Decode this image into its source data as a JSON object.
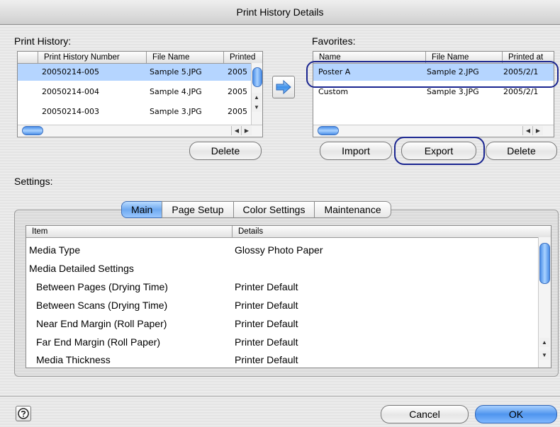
{
  "window": {
    "title": "Print History Details"
  },
  "print_history": {
    "label": "Print History:",
    "columns": [
      "Print History Number",
      "File Name",
      "Printed"
    ],
    "rows": [
      {
        "number": "20050214-005",
        "file": "Sample 5.JPG",
        "printed": "2005"
      },
      {
        "number": "20050214-004",
        "file": "Sample 4.JPG",
        "printed": "2005"
      },
      {
        "number": "20050214-003",
        "file": "Sample 3.JPG",
        "printed": "2005"
      }
    ],
    "delete_label": "Delete"
  },
  "favorites": {
    "label": "Favorites:",
    "columns": [
      "Name",
      "File Name",
      "Printed at"
    ],
    "rows": [
      {
        "name": "Poster A",
        "file": "Sample 2.JPG",
        "printed": "2005/2/1"
      },
      {
        "name": "Custom",
        "file": "Sample 3.JPG",
        "printed": "2005/2/1"
      }
    ],
    "import_label": "Import",
    "export_label": "Export",
    "delete_label": "Delete"
  },
  "settings": {
    "label": "Settings:",
    "tabs": [
      "Main",
      "Page Setup",
      "Color Settings",
      "Maintenance"
    ],
    "active_tab": "Main",
    "columns": [
      "Item",
      "Details"
    ],
    "rows": [
      {
        "item": "Media Type",
        "details": "Glossy Photo Paper"
      },
      {
        "item": "Media Detailed Settings",
        "details": ""
      },
      {
        "item": "Between Pages (Drying Time)",
        "details": "Printer Default"
      },
      {
        "item": "Between Scans (Drying Time)",
        "details": "Printer Default"
      },
      {
        "item": "Near End Margin (Roll Paper)",
        "details": "Printer Default"
      },
      {
        "item": "Far End Margin (Roll Paper)",
        "details": "Printer Default"
      },
      {
        "item": "Media Thickness",
        "details": "Printer Default"
      }
    ]
  },
  "footer": {
    "cancel_label": "Cancel",
    "ok_label": "OK"
  },
  "colors": {
    "selection": "#b5d5ff",
    "highlight_ring": "#1a2590",
    "accent": "#4f95ee"
  },
  "icons": {
    "transfer": "right-arrow-icon",
    "help": "question-mark-icon"
  }
}
